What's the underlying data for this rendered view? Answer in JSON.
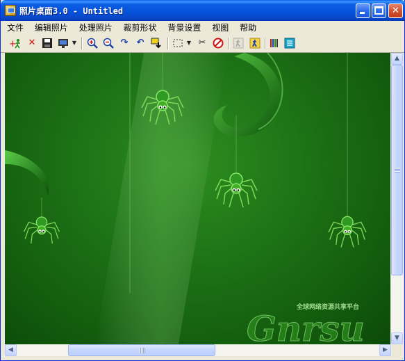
{
  "window": {
    "title": "照片桌面3.0 - Untitled"
  },
  "menu": [
    "文件",
    "编辑照片",
    "处理照片",
    "裁剪形状",
    "背景设置",
    "视图",
    "帮助"
  ],
  "toolbar": {
    "icons": [
      "add-photo-icon",
      "delete-icon",
      "save-icon",
      "monitor-icon",
      "zoom-in-icon",
      "zoom-out-icon",
      "rotate-right-icon",
      "rotate-left-icon",
      "fit-screen-icon",
      "selection-icon",
      "scissors-icon",
      "no-icon",
      "walk-icon",
      "walk-icon-2",
      "bars-icon",
      "list-icon"
    ]
  },
  "wallpaper": {
    "logo_text": "Gnrsu",
    "logo_subtitle": "全球网络资源共享平台"
  },
  "colors": {
    "title_blue": "#0553dc",
    "canvas_green": "#1f7617",
    "spider_green": "#3fae25"
  }
}
